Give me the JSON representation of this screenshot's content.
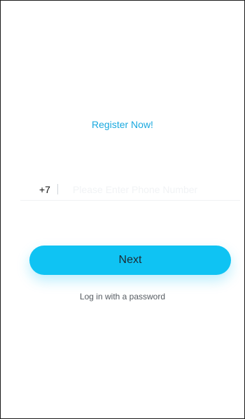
{
  "register": {
    "title": "Register Now!"
  },
  "phone": {
    "country_code": "+7",
    "placeholder": "Please Enter Phone Number",
    "value": ""
  },
  "actions": {
    "next_label": "Next",
    "password_login_label": "Log in with a password"
  },
  "colors": {
    "accent": "#0fc3f3",
    "title": "#1aa9df",
    "link": "#555b61",
    "background": "#ffffff"
  }
}
